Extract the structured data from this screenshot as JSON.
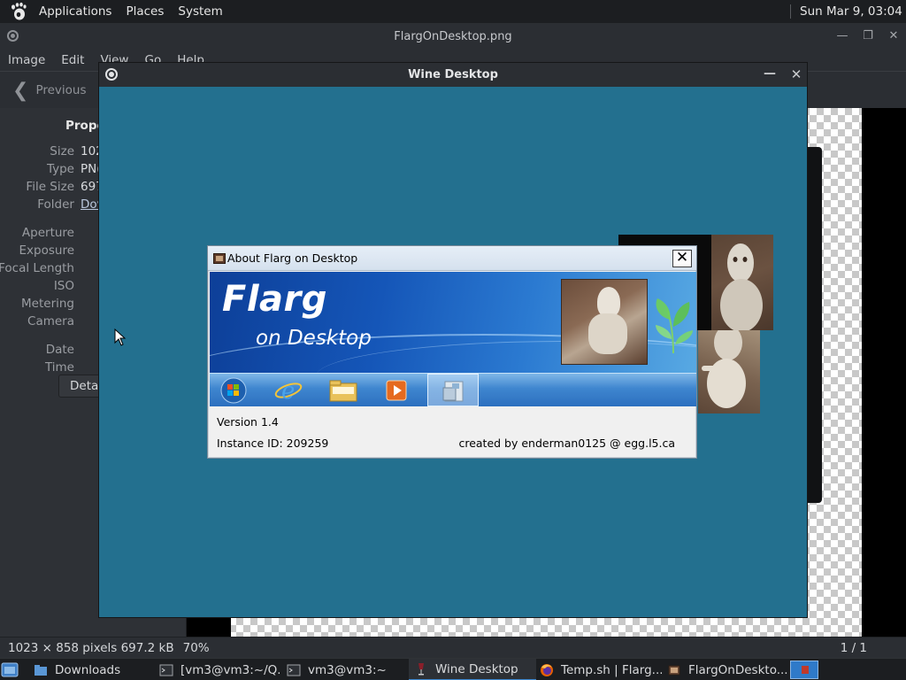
{
  "topbar": {
    "applications": "Applications",
    "places": "Places",
    "system": "System",
    "clock": "Sun Mar  9, 03:04"
  },
  "eog": {
    "title": "FlargOnDesktop.png",
    "menu": [
      "Image",
      "Edit",
      "View",
      "Go",
      "Help"
    ],
    "previous_label": "Previous",
    "properties_title": "Prope",
    "props": [
      {
        "label": "Size",
        "value": "102"
      },
      {
        "label": "Type",
        "value": "PN("
      },
      {
        "label": "File Size",
        "value": "697"
      },
      {
        "label": "Folder",
        "value": "Dov"
      }
    ],
    "exif_labels": [
      "Aperture",
      "Exposure",
      "Focal Length",
      "ISO",
      "Metering",
      "Camera"
    ],
    "date_labels": [
      "Date",
      "Time"
    ],
    "details_label": "Detai",
    "status": {
      "dims": "1023 × 858 pixels  697.2 kB",
      "zoom": "70%",
      "position": "1 / 1"
    }
  },
  "wine": {
    "title": "Wine Desktop",
    "about": {
      "title": "About Flarg on Desktop",
      "close": "✕",
      "brand_main": "Flarg",
      "brand_sub": "on Desktop",
      "version": "Version 1.4",
      "instance": "Instance ID:  209259",
      "created": "created by enderman0125 @ egg.l5.ca"
    }
  },
  "taskbar": {
    "tasks": [
      {
        "label": "Downloads",
        "icon": "folder-icon"
      },
      {
        "label": "[vm3@vm3:~/Q...",
        "icon": "terminal-icon"
      },
      {
        "label": "vm3@vm3:~",
        "icon": "terminal-icon"
      },
      {
        "label": "Wine Desktop",
        "icon": "wine-icon"
      },
      {
        "label": "Temp.sh | Flarg...",
        "icon": "firefox-icon"
      },
      {
        "label": "FlargOnDeskto...",
        "icon": "image-viewer-icon"
      }
    ]
  },
  "colors": {
    "wine_desktop_bg": "#23708f",
    "panel_bg": "#1c1e21",
    "window_bg": "#2b2e33"
  }
}
